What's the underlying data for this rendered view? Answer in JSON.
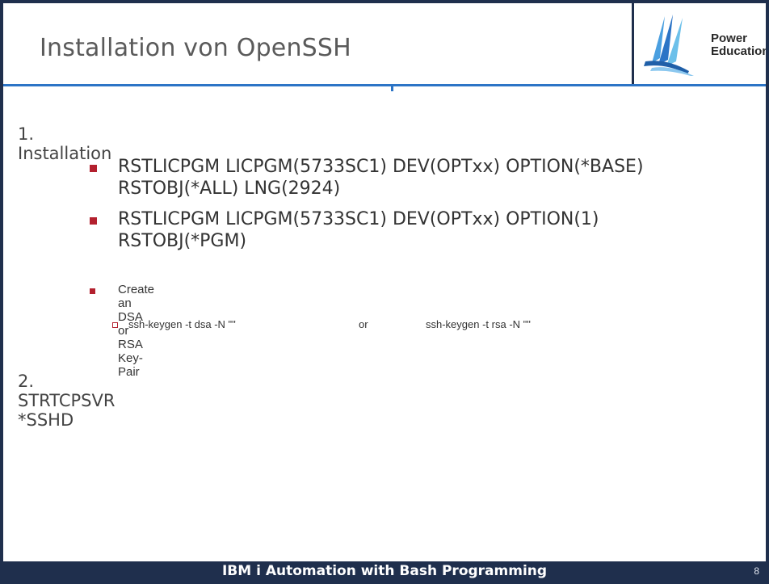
{
  "slide": {
    "title": "Installation von OpenSSH",
    "logo": {
      "line1": "Power",
      "line2": "Education"
    },
    "items": {
      "step1": "1. Installation",
      "bullet1_line1": "RSTLICPGM LICPGM(5733SC1) DEV(OPTxx) OPTION(*BASE)",
      "bullet1_line2": "RSTOBJ(*ALL) LNG(2924)",
      "bullet2_line1": "RSTLICPGM LICPGM(5733SC1) DEV(OPTxx) OPTION(1)",
      "bullet2_line2": "RSTOBJ(*PGM)",
      "bullet3": "Create an DSA or RSA Key-Pair",
      "sub_cmd_dsa": "ssh-keygen -t dsa -N \"\"",
      "sub_or": "or",
      "sub_cmd_rsa": "ssh-keygen -t rsa -N \"\"",
      "step2": "2. STRTCPSVR *SSHD"
    },
    "footer": "IBM i Automation with Bash Programming",
    "page_number": "8"
  },
  "colors": {
    "dark_navy": "#1f2f4d",
    "accent_blue": "#2c74c6",
    "bullet_red": "#b3202e"
  }
}
